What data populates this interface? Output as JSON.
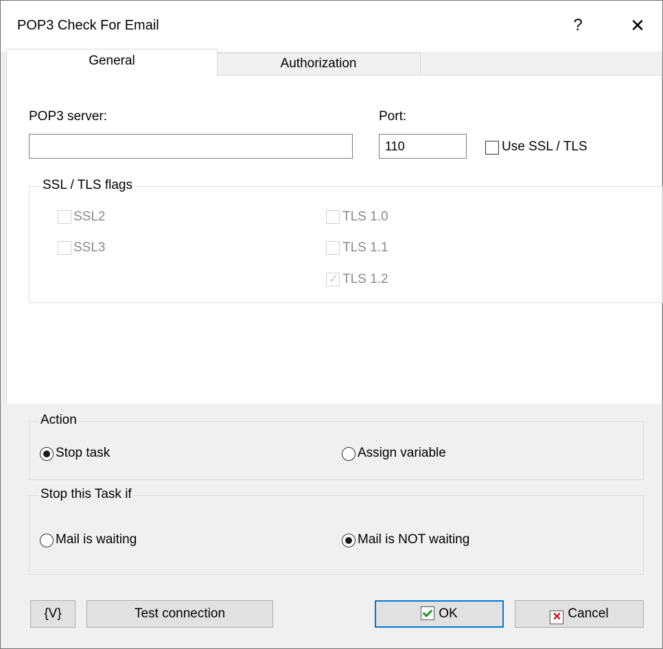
{
  "window": {
    "title": "POP3 Check For Email",
    "help_glyph": "?",
    "close_glyph": "✕"
  },
  "tabs": [
    {
      "label": "General",
      "active": true
    },
    {
      "label": "Authorization",
      "active": false
    }
  ],
  "general": {
    "server_label": "POP3 server:",
    "server_value": "",
    "port_label": "Port:",
    "port_value": "110",
    "use_ssl_label": "Use SSL / TLS",
    "use_ssl_checked": false
  },
  "ssl_flags": {
    "title": "SSL / TLS flags",
    "items": [
      {
        "label": "SSL2",
        "checked": false,
        "enabled": false
      },
      {
        "label": "SSL3",
        "checked": false,
        "enabled": false
      },
      {
        "label": "TLS 1.0",
        "checked": false,
        "enabled": false
      },
      {
        "label": "TLS 1.1",
        "checked": false,
        "enabled": false
      },
      {
        "label": "TLS 1.2",
        "checked": true,
        "enabled": false
      }
    ]
  },
  "action": {
    "title": "Action",
    "options": [
      {
        "label": "Stop task",
        "selected": true
      },
      {
        "label": "Assign variable",
        "selected": false
      }
    ]
  },
  "stop_if": {
    "title": "Stop this Task if",
    "options": [
      {
        "label": "Mail is waiting",
        "selected": false
      },
      {
        "label": "Mail is NOT waiting",
        "selected": true
      }
    ]
  },
  "buttons": {
    "variables": "{V}",
    "test": "Test connection",
    "ok": "OK",
    "cancel": "Cancel"
  },
  "colors": {
    "accent": "#0078d7",
    "dialog_bg": "#f0f0f0",
    "ok_check": "#1c9a1c",
    "cancel_x": "#d0021b"
  }
}
